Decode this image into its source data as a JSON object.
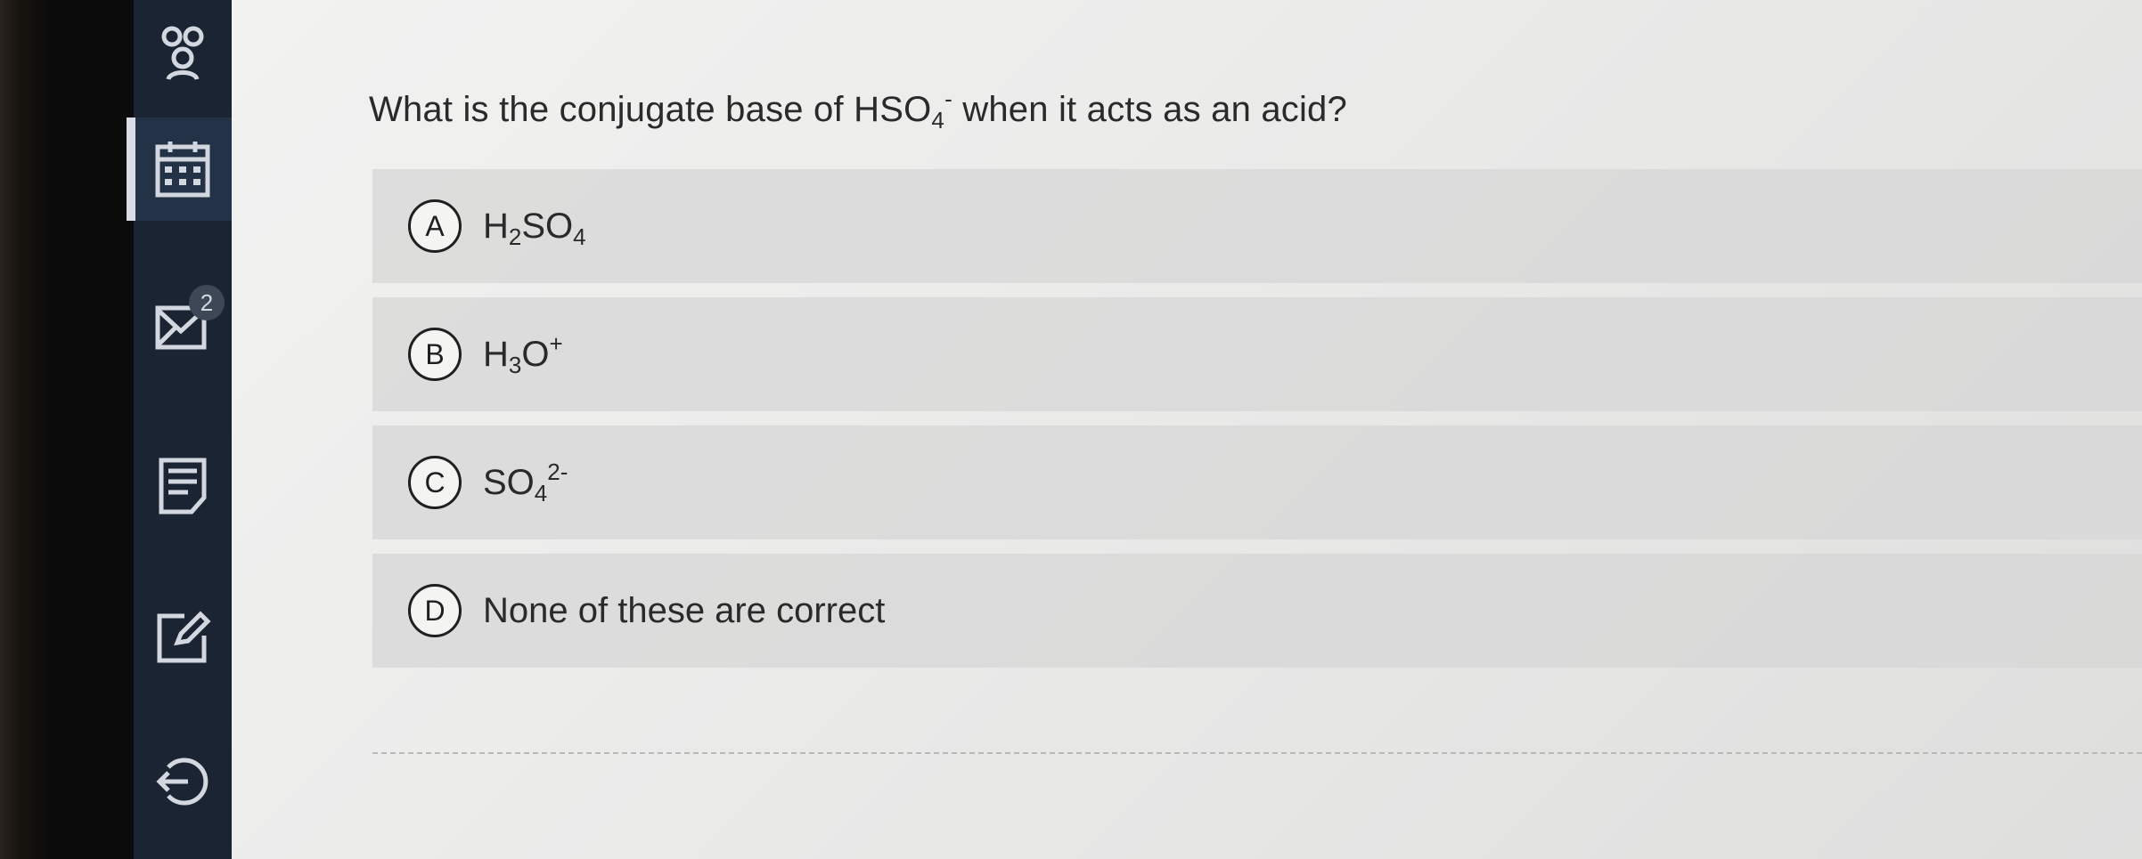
{
  "sidebar": {
    "items": [
      {
        "icon": "people-icon",
        "active": false
      },
      {
        "icon": "calendar-icon",
        "active": true
      },
      {
        "icon": "mail-icon",
        "active": false,
        "badge": "2"
      },
      {
        "icon": "notes-icon",
        "active": false
      },
      {
        "icon": "edit-icon",
        "active": false
      },
      {
        "icon": "logout-icon",
        "active": false
      }
    ]
  },
  "question": {
    "text_pre": "What is the conjugate base of HSO",
    "sub": "4",
    "sup": "-",
    "text_post": " when it acts as an acid?"
  },
  "options": [
    {
      "letter": "A",
      "p1": "H",
      "s1": "2",
      "p2": "SO",
      "s2": "4",
      "sup": ""
    },
    {
      "letter": "B",
      "p1": "H",
      "s1": "3",
      "p2": "O",
      "s2": "",
      "sup": "+"
    },
    {
      "letter": "C",
      "p1": "SO",
      "s1": "4",
      "p2": "",
      "s2": "",
      "sup": "2-"
    },
    {
      "letter": "D",
      "p1": "None of these are correct",
      "s1": "",
      "p2": "",
      "s2": "",
      "sup": ""
    }
  ],
  "colors": {
    "sidebar_bg": "#1b2433",
    "content_bg": "#ececeb",
    "option_bg": "#d6d6d5",
    "text": "#2a2a2a"
  }
}
